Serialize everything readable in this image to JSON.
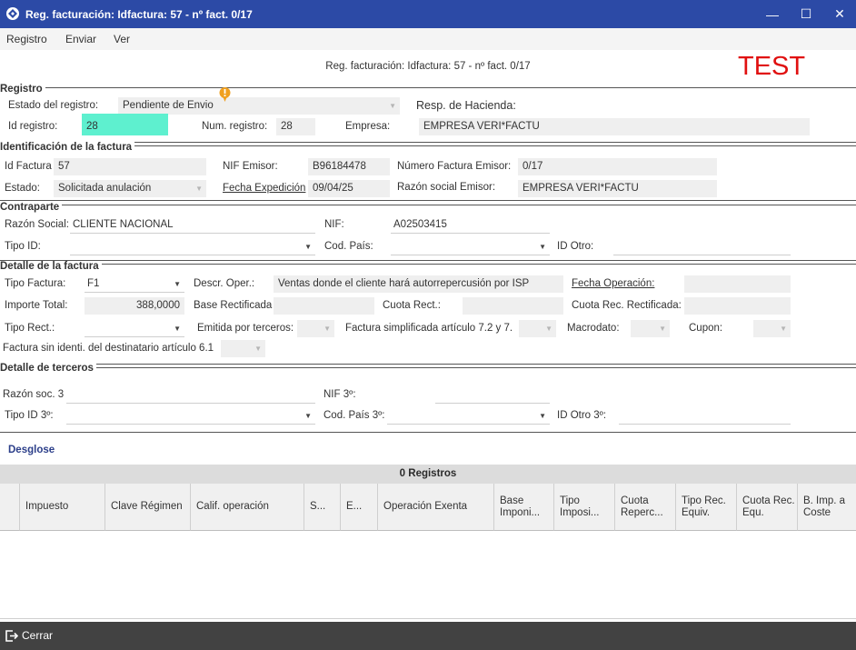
{
  "window": {
    "title": "Reg. facturación: Idfactura: 57 - nº fact. 0/17",
    "minimize": "—",
    "maximize": "☐",
    "close": "✕"
  },
  "menu": [
    "Registro",
    "Enviar",
    "Ver"
  ],
  "subtitle": "Reg. facturación: Idfactura: 57 - nº fact. 0/17",
  "badge": "TEST",
  "registro": {
    "section": "Registro",
    "estado_label": "Estado del registro:",
    "estado_value": "Pendiente de Envio",
    "resp_label": "Resp. de Hacienda:",
    "id_label": "Id registro:",
    "id_value": "28",
    "num_label": "Num. registro:",
    "num_value": "28",
    "empresa_label": "Empresa:",
    "empresa_value": "EMPRESA VERI*FACTU"
  },
  "identificacion": {
    "section": "Identificación de la factura",
    "idfactura_label": "Id Factura",
    "idfactura_value": "57",
    "nif_label": "NIF Emisor:",
    "nif_value": "B96184478",
    "numfact_label": "Número Factura Emisor:",
    "numfact_value": "0/17",
    "estado_label": "Estado:",
    "estado_value": "Solicitada anulación",
    "fechaexp_label": "Fecha Expedición",
    "fechaexp_value": "09/04/25",
    "razon_label": "Razón social Emisor:",
    "razon_value": "EMPRESA VERI*FACTU"
  },
  "contraparte": {
    "section": "Contraparte",
    "razon_label": "Razón Social:",
    "razon_value": "CLIENTE NACIONAL",
    "nif_label": "NIF:",
    "nif_value": "A02503415",
    "tipoid_label": "Tipo ID:",
    "codpais_label": "Cod. País:",
    "idotro_label": "ID Otro:"
  },
  "detalle": {
    "section": "Detalle de la factura",
    "tipofact_label": "Tipo Factura:",
    "tipofact_value": "F1",
    "descr_label": "Descr. Oper.:",
    "descr_value": "Ventas donde el cliente hará autorrepercusión por ISP",
    "fechaop_label": "Fecha Operación:",
    "importe_label": "Importe Total:",
    "importe_value": "388,0000",
    "baserect_label": "Base Rectificada",
    "cuotarect_label": "Cuota Rect.:",
    "cuotarecrect_label": "Cuota Rec. Rectificada:",
    "tiporect_label": "Tipo Rect.:",
    "emitida_label": "Emitida por terceros:",
    "simplificada_label": "Factura simplificada artículo 7.2 y 7.",
    "macrodato_label": "Macrodato:",
    "cupon_label": "Cupon:",
    "sinidenti_label": "Factura sin identi. del destinatario artículo 6.1"
  },
  "terceros": {
    "section": "Detalle de terceros",
    "razon_label": "Razón soc. 3",
    "nif_label": "NIF 3º:",
    "tipoid_label": "Tipo ID 3º:",
    "codpais_label": "Cod. País 3º:",
    "idotro_label": "ID Otro 3º:"
  },
  "desglose": {
    "title": "Desglose",
    "count": "0 Registros",
    "columns": [
      "Impuesto",
      "Clave Régimen",
      "Calif. operación",
      "S...",
      "E...",
      "Operación Exenta",
      "Base Imponi...",
      "Tipo Imposi...",
      "Cuota Reperc...",
      "Tipo Rec. Equiv.",
      "Cuota Rec. Equ.",
      "B. Imp. a Coste"
    ]
  },
  "footer": {
    "close_label": "Cerrar"
  },
  "colors": {
    "titlebar": "#2c4aa6",
    "accent_field": "#5ef0cf",
    "test": "#e01010",
    "footer": "#424242"
  }
}
